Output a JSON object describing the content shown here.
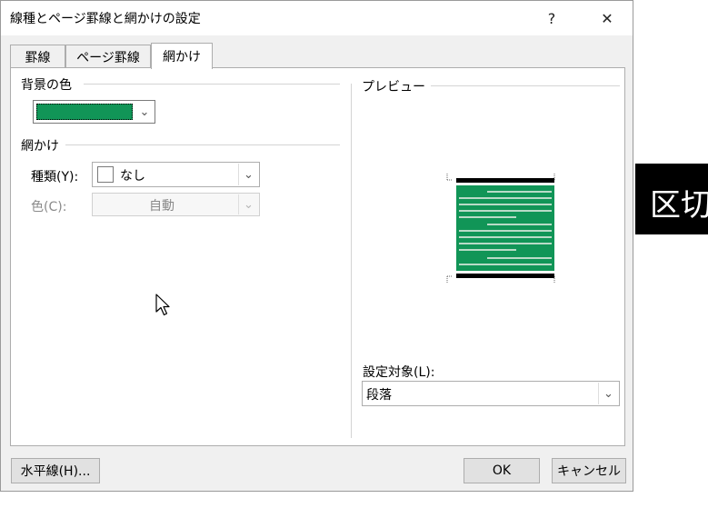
{
  "dialog": {
    "title": "線種とページ罫線と網かけの設定",
    "help_label": "?",
    "close_label": "✕"
  },
  "tabs": [
    {
      "label": "罫線",
      "active": false
    },
    {
      "label": "ページ罫線",
      "active": false
    },
    {
      "label": "網かけ",
      "active": true
    }
  ],
  "background": {
    "label": "背景の色",
    "color": "#119557"
  },
  "shading": {
    "label": "網かけ",
    "style_label": "種類(Y):",
    "style_value": "なし",
    "color_label": "色(C):",
    "color_value": "自動"
  },
  "preview": {
    "label": "プレビュー",
    "fill_color": "#119557",
    "line_color": "#b9dbc7"
  },
  "apply_to": {
    "label": "設定対象(L):",
    "value": "段落"
  },
  "buttons": {
    "horizontal_line": "水平線(H)...",
    "ok": "OK",
    "cancel": "キャンセル"
  },
  "side_text": "区切"
}
